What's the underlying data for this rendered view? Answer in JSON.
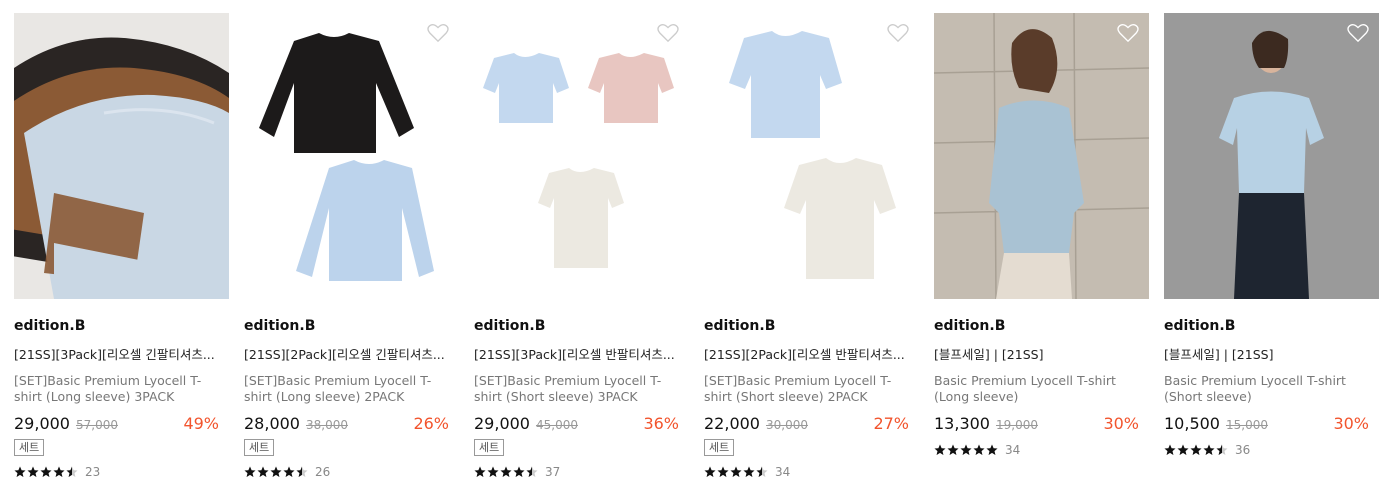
{
  "products": [
    {
      "brand": "edition.B",
      "title": "[21SS][3Pack][리오셀 긴팔티셔츠...",
      "subtitle": "[SET]Basic Premium Lyocell T-shirt (Long sleeve) 3PACK",
      "price": "29,000",
      "original_price": "57,000",
      "discount": "49%",
      "badge": "세트",
      "rating": 4.5,
      "review_count": "23",
      "image": "three-long-sleeve-tees-stacked"
    },
    {
      "brand": "edition.B",
      "title": "[21SS][2Pack][리오셀 긴팔티셔츠...",
      "subtitle": "[SET]Basic Premium Lyocell T-shirt (Long sleeve) 2PACK",
      "price": "28,000",
      "original_price": "38,000",
      "discount": "26%",
      "badge": "세트",
      "rating": 4.5,
      "review_count": "26",
      "image": "black-and-blue-long-sleeve-tees"
    },
    {
      "brand": "edition.B",
      "title": "[21SS][3Pack][리오셀 반팔티셔츠...",
      "subtitle": "[SET]Basic Premium Lyocell T-shirt (Short sleeve) 3PACK",
      "price": "29,000",
      "original_price": "45,000",
      "discount": "36%",
      "badge": "세트",
      "rating": 4.5,
      "review_count": "37",
      "image": "blue-pink-ivory-short-sleeve-tees"
    },
    {
      "brand": "edition.B",
      "title": "[21SS][2Pack][리오셀 반팔티셔츠...",
      "subtitle": "[SET]Basic Premium Lyocell T-shirt (Short sleeve) 2PACK",
      "price": "22,000",
      "original_price": "30,000",
      "discount": "27%",
      "badge": "세트",
      "rating": 4.5,
      "review_count": "34",
      "image": "blue-and-ivory-short-sleeve-tees"
    },
    {
      "brand": "edition.B",
      "title": "[블프세일] | [21SS]",
      "subtitle": "Basic Premium Lyocell T-shirt (Long sleeve)",
      "price": "13,300",
      "original_price": "19,000",
      "discount": "30%",
      "badge": "",
      "rating": 5,
      "review_count": "34",
      "image": "model-long-sleeve-outdoor"
    },
    {
      "brand": "edition.B",
      "title": "[블프세일] | [21SS]",
      "subtitle": "Basic Premium Lyocell T-shirt (Short sleeve)",
      "price": "10,500",
      "original_price": "15,000",
      "discount": "30%",
      "badge": "",
      "rating": 4.5,
      "review_count": "36",
      "image": "model-short-sleeve-studio"
    }
  ],
  "icons": {
    "wishlist": "heart-outline-icon",
    "star": "star-icon"
  },
  "colors": {
    "discount": "#f2542d",
    "star": "#111111",
    "muted_text": "#777777"
  }
}
